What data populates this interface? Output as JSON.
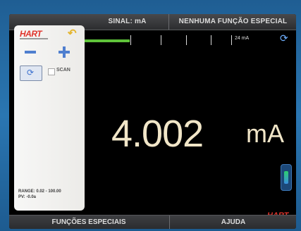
{
  "header": {
    "signal_label": "SINAL: mA",
    "special_function_label": "NENHUMA FUNÇÃO ESPECIAL"
  },
  "scale": {
    "max_label": "24 mA"
  },
  "reading": {
    "value": "4.002",
    "unit": "mA"
  },
  "panel": {
    "logo_text": "HART",
    "scan_label": "SCAN",
    "range_text": "RANGE: 0.02 - 100.00",
    "pv_text": "PV: -0.0a"
  },
  "footer": {
    "special_functions_label": "FUNÇÕES ESPECIAIS",
    "help_label": "AJUDA"
  },
  "brand": {
    "logo_text": "HART"
  },
  "colors": {
    "bezel": "#2a76b2",
    "reading": "#f1e6c8",
    "accent_green": "#5fc33a",
    "hart_red": "#e0342c"
  },
  "icons": [
    "back-arrow-icon",
    "minus-icon",
    "plus-icon",
    "refresh-icon",
    "checkbox-icon"
  ]
}
